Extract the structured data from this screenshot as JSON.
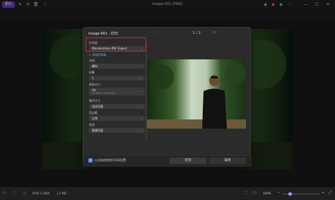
{
  "window": {
    "app_badge": "照片",
    "title": "image-001 (PNG)",
    "controls": [
      "—",
      "☐",
      "✕"
    ]
  },
  "dialog": {
    "title": "image-001 - 打印",
    "printer_label": "打印机",
    "printer_value": "Wondershare PDF Expert",
    "add_printer": "添加打印机",
    "orientation_label": "方向",
    "orientation_value": "横向",
    "copies_label": "份数",
    "copies_value": "1",
    "paper_size_label": "纸张大小",
    "paper_size_value": "A4",
    "paper_size_detail": "21.0cm x 29.70cm",
    "photo_size_label": "照片尺寸",
    "photo_size_value": "适应页面",
    "page_margins_label": "页边距",
    "page_margins_value": "正常",
    "fit_label": "适合",
    "fit_value": "填满页面",
    "pager": "1 / 1",
    "open_after_label": "以后始终使用打印机设置",
    "print_button": "打印",
    "cancel_button": "取消"
  },
  "statusbar": {
    "dimensions": "1920 x 1080",
    "filesize": "1.4 MB",
    "zoom": "100%"
  }
}
